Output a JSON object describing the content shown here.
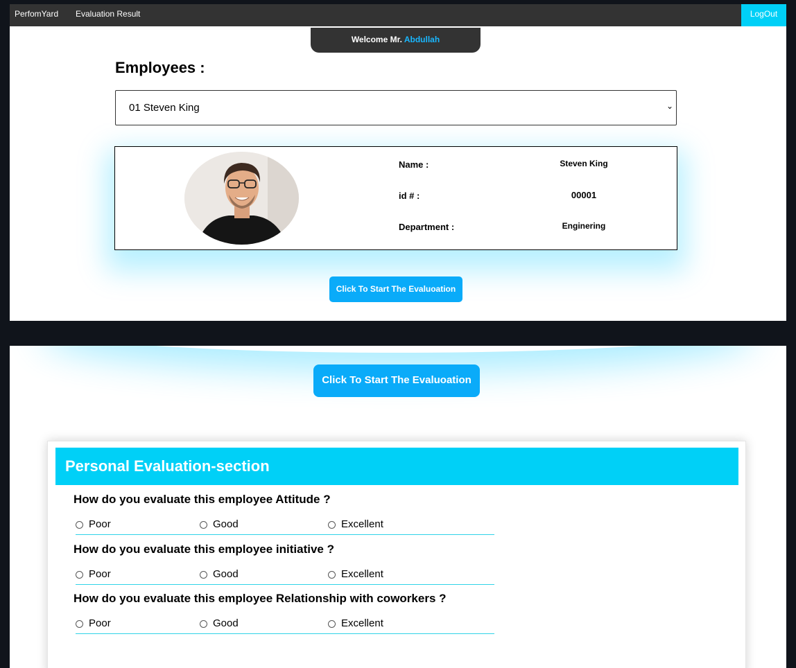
{
  "nav": {
    "brand": "PerfomYard",
    "evaluation_result": "Evaluation Result",
    "logout": "LogOut"
  },
  "welcome": {
    "prefix": "Welcome Mr.",
    "user": "Abdullah"
  },
  "employees": {
    "heading": "Employees :",
    "selected": "01 Steven King"
  },
  "profile": {
    "name_label": "Name :",
    "name_value": "Steven King",
    "id_label": "id # :",
    "id_value": "00001",
    "department_label": "Department :",
    "department_value": "Enginering"
  },
  "start_button": "Click To Start The Evaluoation",
  "evaluation": {
    "section_title": "Personal Evaluation-section",
    "questions": [
      {
        "text": "How do you evaluate this employee Attitude ?",
        "options": [
          "Poor",
          "Good",
          "Excellent"
        ]
      },
      {
        "text": "How do you evaluate this employee initiative ?",
        "options": [
          "Poor",
          "Good",
          "Excellent"
        ]
      },
      {
        "text": "How do you evaluate this employee Relationship with coworkers ?",
        "options": [
          "Poor",
          "Good",
          "Excellent"
        ]
      }
    ]
  },
  "colors": {
    "navbar": "#333333",
    "accent_cyan": "#00d0f7",
    "button_blue": "#0aabf9",
    "username_blue": "#19b7ff"
  }
}
